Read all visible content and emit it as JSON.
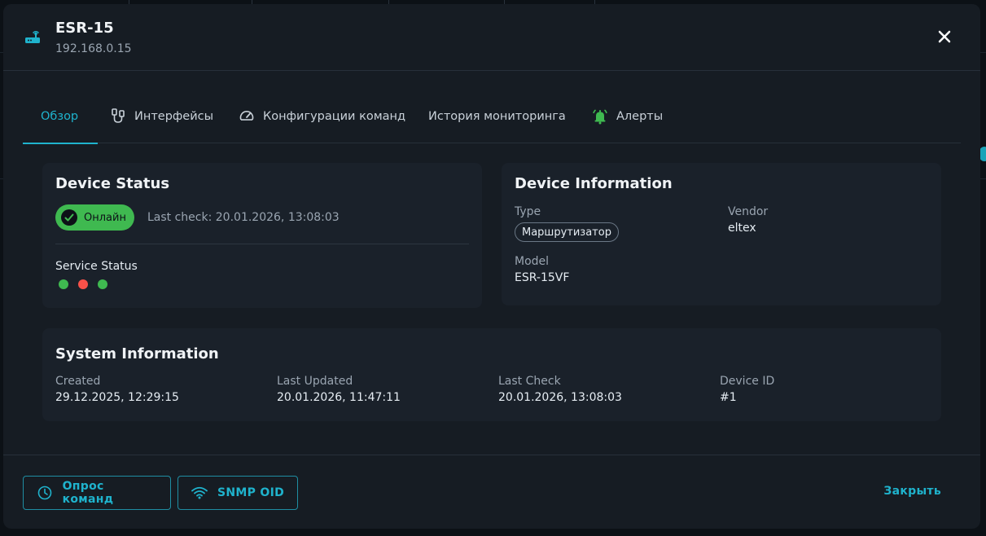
{
  "header": {
    "title": "ESR-15",
    "ip": "192.168.0.15",
    "icon": "router-icon",
    "close_icon": "close-icon"
  },
  "tabs": [
    {
      "label": "Обзор",
      "icon": null,
      "active": true
    },
    {
      "label": "Интерфейсы",
      "icon": "ethernet-port-icon",
      "active": false
    },
    {
      "label": "Конфигурации команд",
      "icon": "speedometer-icon",
      "active": false
    },
    {
      "label": "История мониторинга",
      "icon": null,
      "active": false
    },
    {
      "label": "Алерты",
      "icon": "bell-icon",
      "active": false
    }
  ],
  "device_status": {
    "title": "Device Status",
    "status": "Онлайн",
    "last_check": "Last check: 20.01.2026, 13:08:03",
    "service_status_label": "Service Status",
    "services": [
      "ok",
      "error",
      "ok"
    ]
  },
  "device_info": {
    "title": "Device Information",
    "type_label": "Type",
    "type_value": "Маршрутизатор",
    "vendor_label": "Vendor",
    "vendor_value": "eltex",
    "model_label": "Model",
    "model_value": "ESR-15VF"
  },
  "system_info": {
    "title": "System Information",
    "created_label": "Created",
    "created_value": "29.12.2025, 12:29:15",
    "updated_label": "Last Updated",
    "updated_value": "20.01.2026, 11:47:11",
    "check_label": "Last Check",
    "check_value": "20.01.2026, 13:08:03",
    "id_label": "Device ID",
    "id_value": "#1"
  },
  "footer": {
    "poll_button": "Опрос команд",
    "snmp_button": "SNMP OID",
    "close_button": "Закрыть"
  },
  "colors": {
    "accent": "#1fb3cd",
    "online": "#3fb950",
    "error": "#f85149",
    "alert_icon": "#3fb950"
  }
}
